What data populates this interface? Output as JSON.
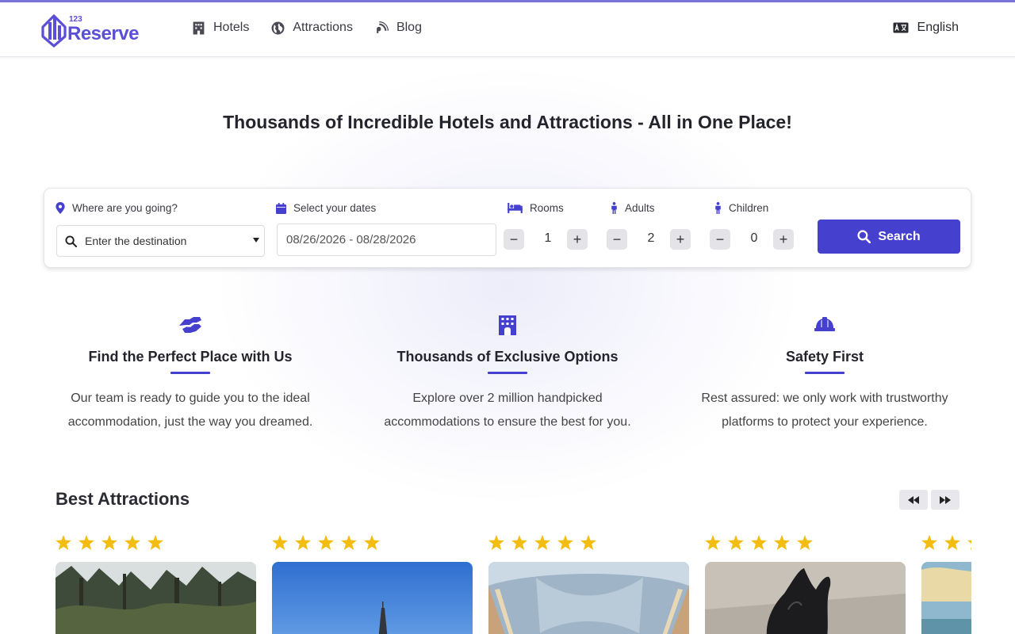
{
  "header": {
    "logo_number": "123",
    "logo_text": "Reserve",
    "nav": [
      {
        "label": "Hotels",
        "icon": "building-icon"
      },
      {
        "label": "Attractions",
        "icon": "globe-icon"
      },
      {
        "label": "Blog",
        "icon": "blog-icon"
      }
    ],
    "language": "English"
  },
  "hero": {
    "title": "Thousands of Incredible Hotels and Attractions - All in One Place!"
  },
  "search": {
    "destination_label": "Where are you going?",
    "destination_placeholder": "Enter the destination",
    "dates_label": "Select your dates",
    "dates_value": "08/26/2026 - 08/28/2026",
    "rooms_label": "Rooms",
    "rooms_value": "1",
    "adults_label": "Adults",
    "adults_value": "2",
    "children_label": "Children",
    "children_value": "0",
    "search_label": "Search"
  },
  "features": [
    {
      "title": "Find the Perfect Place with Us",
      "text": "Our team is ready to guide you to the ideal accommodation, just the way you dreamed.",
      "icon": "handshake-icon"
    },
    {
      "title": "Thousands of Exclusive Options",
      "text": "Explore over 2 million handpicked accommodations to ensure the best for you.",
      "icon": "hotel-icon"
    },
    {
      "title": "Safety First",
      "text": "Rest assured: we only work with trustworthy platforms to protect your experience.",
      "icon": "hard-hat-icon"
    }
  ],
  "attractions": {
    "title": "Best Attractions",
    "cards": [
      {
        "rating": 5,
        "image": "forest-pine-trees"
      },
      {
        "rating": 5,
        "image": "blue-sky-tower"
      },
      {
        "rating": 5,
        "image": "arched-ceiling-hall"
      },
      {
        "rating": 5,
        "image": "dark-sculpture"
      },
      {
        "rating": 5,
        "image": "beach-sky"
      }
    ]
  },
  "colors": {
    "accent": "#4640cf",
    "logo": "#5a4fd6",
    "star": "#f2bd0f",
    "top_border": "#7b73d9"
  }
}
